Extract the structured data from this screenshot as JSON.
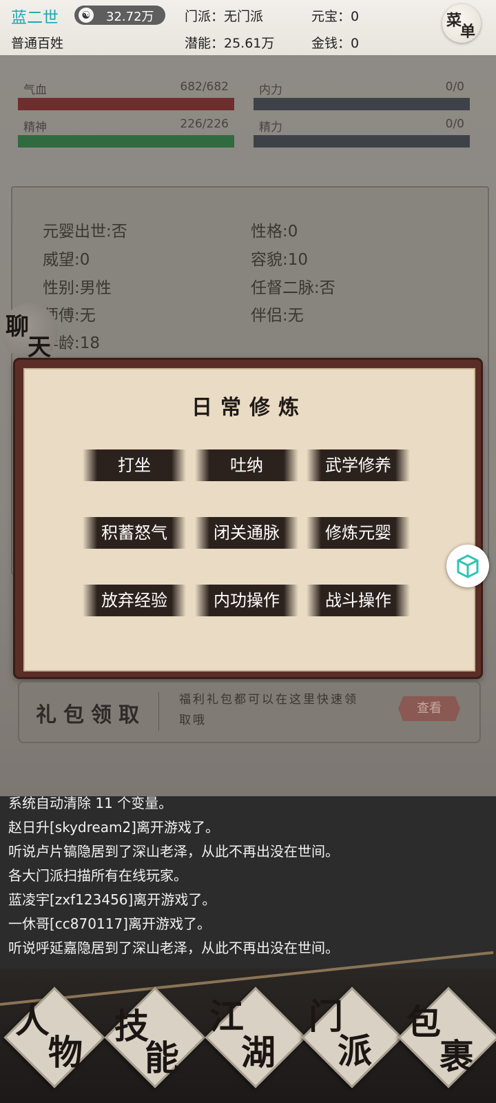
{
  "header": {
    "player_name": "蓝二世",
    "rank": "普通百姓",
    "coin_icon": "yin-yang-icon",
    "coin_value": "32.72万",
    "sect": "门派：无门派",
    "potential": "潜能：25.61万",
    "yuanbao": "元宝：0",
    "money": "金钱：0",
    "menu_char1": "菜",
    "menu_char2": "单"
  },
  "stats": {
    "hp_label": "气血",
    "hp_value": "682/682",
    "hp_ratio": 1.0,
    "inner_label": "内力",
    "inner_value": "0/0",
    "inner_ratio": 0,
    "spirit_label": "精神",
    "spirit_value": "226/226",
    "spirit_ratio": 1.0,
    "energy_label": "精力",
    "energy_value": "0/0",
    "energy_ratio": 0,
    "colors": {
      "hp": "#6e2e2e",
      "spirit": "#2f6b3f",
      "empty": "#3e4248"
    }
  },
  "info": {
    "items": [
      "元婴出世:否",
      "性格:0",
      "威望:0",
      "容貌:10",
      "性别:男性",
      "任督二脉:否",
      "师傅:无",
      "伴侣:无",
      "年龄:18"
    ]
  },
  "chat_button": {
    "char1": "聊",
    "char2": "天"
  },
  "dialog": {
    "title": "日常修炼",
    "buttons": [
      "打坐",
      "吐纳",
      "武学修养",
      "积蓄怒气",
      "闭关通脉",
      "修炼元婴",
      "放弃经验",
      "内功操作",
      "战斗操作"
    ]
  },
  "float_button": {
    "icon": "cube-icon",
    "color": "#2fc4b5"
  },
  "gift": {
    "title": "礼包领取",
    "desc_line1": "福利礼包都可以在这里快速领",
    "desc_line2": "取哦",
    "view_label": "查看"
  },
  "chat_log": [
    "系统自动清除 11 个变量。",
    "赵日升[skydream2]离开游戏了。",
    "听说卢片镐隐居到了深山老泽，从此不再出没在世间。",
    "各大门派扫描所有在线玩家。",
    "蓝凌宇[zxf123456]离开游戏了。",
    "一休哥[cc870117]离开游戏了。",
    "听说呼延嘉隐居到了深山老泽，从此不再出没在世间。"
  ],
  "bottom_nav": [
    {
      "char1": "人",
      "char2": "物"
    },
    {
      "char1": "技",
      "char2": "能"
    },
    {
      "char1": "江",
      "char2": "湖"
    },
    {
      "char1": "门",
      "char2": "派"
    },
    {
      "char1": "包",
      "char2": "裹"
    }
  ]
}
